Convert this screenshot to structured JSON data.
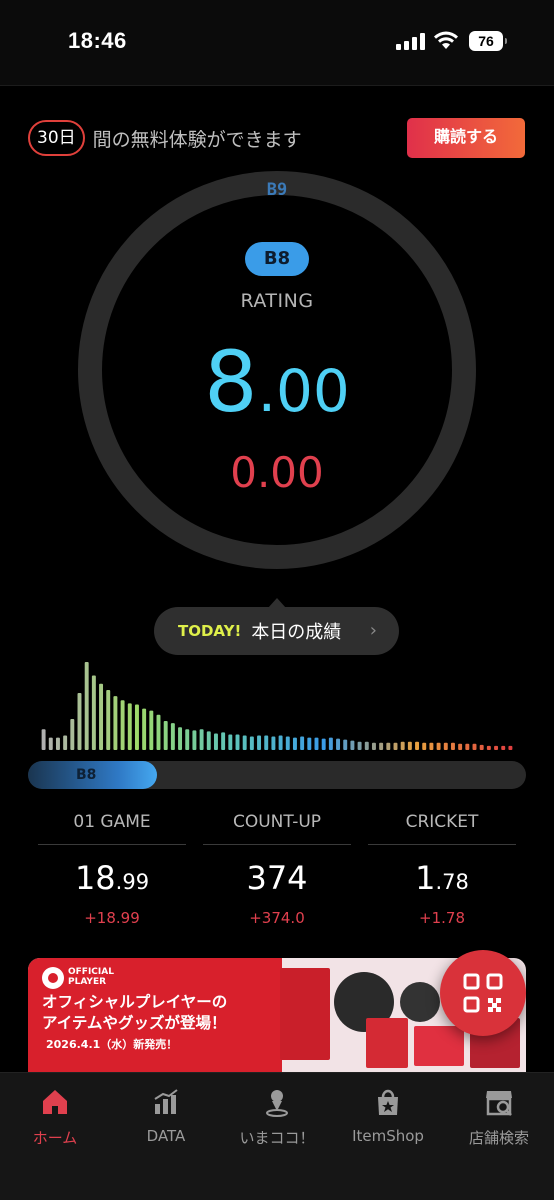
{
  "status_bar": {
    "time": "18:46",
    "battery": "76"
  },
  "trial": {
    "days": "30日",
    "text": "間の無料体験ができます",
    "subscribe_label": "購読する"
  },
  "rating": {
    "next_rank": "B9",
    "current_rank": "B8",
    "label": "RATING",
    "value_int": "8",
    "value_dec": ".00",
    "diff": "0.00",
    "ring_progress": 0.0
  },
  "today": {
    "tag": "TODAY!",
    "label": "本日の成績"
  },
  "histogram": {
    "values": [
      20,
      12,
      12,
      14,
      30,
      55,
      85,
      72,
      64,
      58,
      52,
      48,
      45,
      44,
      40,
      38,
      34,
      28,
      26,
      22,
      20,
      19,
      20,
      18,
      16,
      17,
      15,
      15,
      14,
      13,
      14,
      14,
      13,
      14,
      13,
      12,
      13,
      12,
      12,
      11,
      12,
      11,
      10,
      9,
      8,
      8,
      7,
      7,
      7,
      7,
      8,
      8,
      8,
      7,
      7,
      7,
      7,
      7,
      6,
      6,
      6,
      5,
      4,
      4,
      4,
      4
    ],
    "colors": [
      "#b0b0b0",
      "#9ed96a",
      "#5fc4b8",
      "#3a9ce8",
      "#e8a040",
      "#e04040"
    ]
  },
  "progress": {
    "rank_label": "B8",
    "fill_fraction": 0.26
  },
  "stats": [
    {
      "title": "01 GAME",
      "big": "18",
      "small": ".99",
      "diff": "+18.99"
    },
    {
      "title": "COUNT-UP",
      "big": "374",
      "small": "",
      "diff": "+374.0"
    },
    {
      "title": "CRICKET",
      "big": "1",
      "small": ".78",
      "diff": "+1.78"
    }
  ],
  "banner": {
    "logo_text": "OFFICIAL PLAYER",
    "headline_1": "オフィシャルプレイヤーの",
    "headline_2": "アイテムやグッズが登場！",
    "date": "2026.4.1（水）新発売！"
  },
  "nav": [
    {
      "label": "ホーム",
      "icon": "home-icon",
      "active": true
    },
    {
      "label": "DATA",
      "icon": "chart-icon",
      "active": false
    },
    {
      "label": "いまココ！",
      "icon": "location-pin-icon",
      "active": false
    },
    {
      "label": "ItemShop",
      "icon": "shop-bag-icon",
      "active": false
    },
    {
      "label": "店舗検索",
      "icon": "store-search-icon",
      "active": false
    }
  ]
}
